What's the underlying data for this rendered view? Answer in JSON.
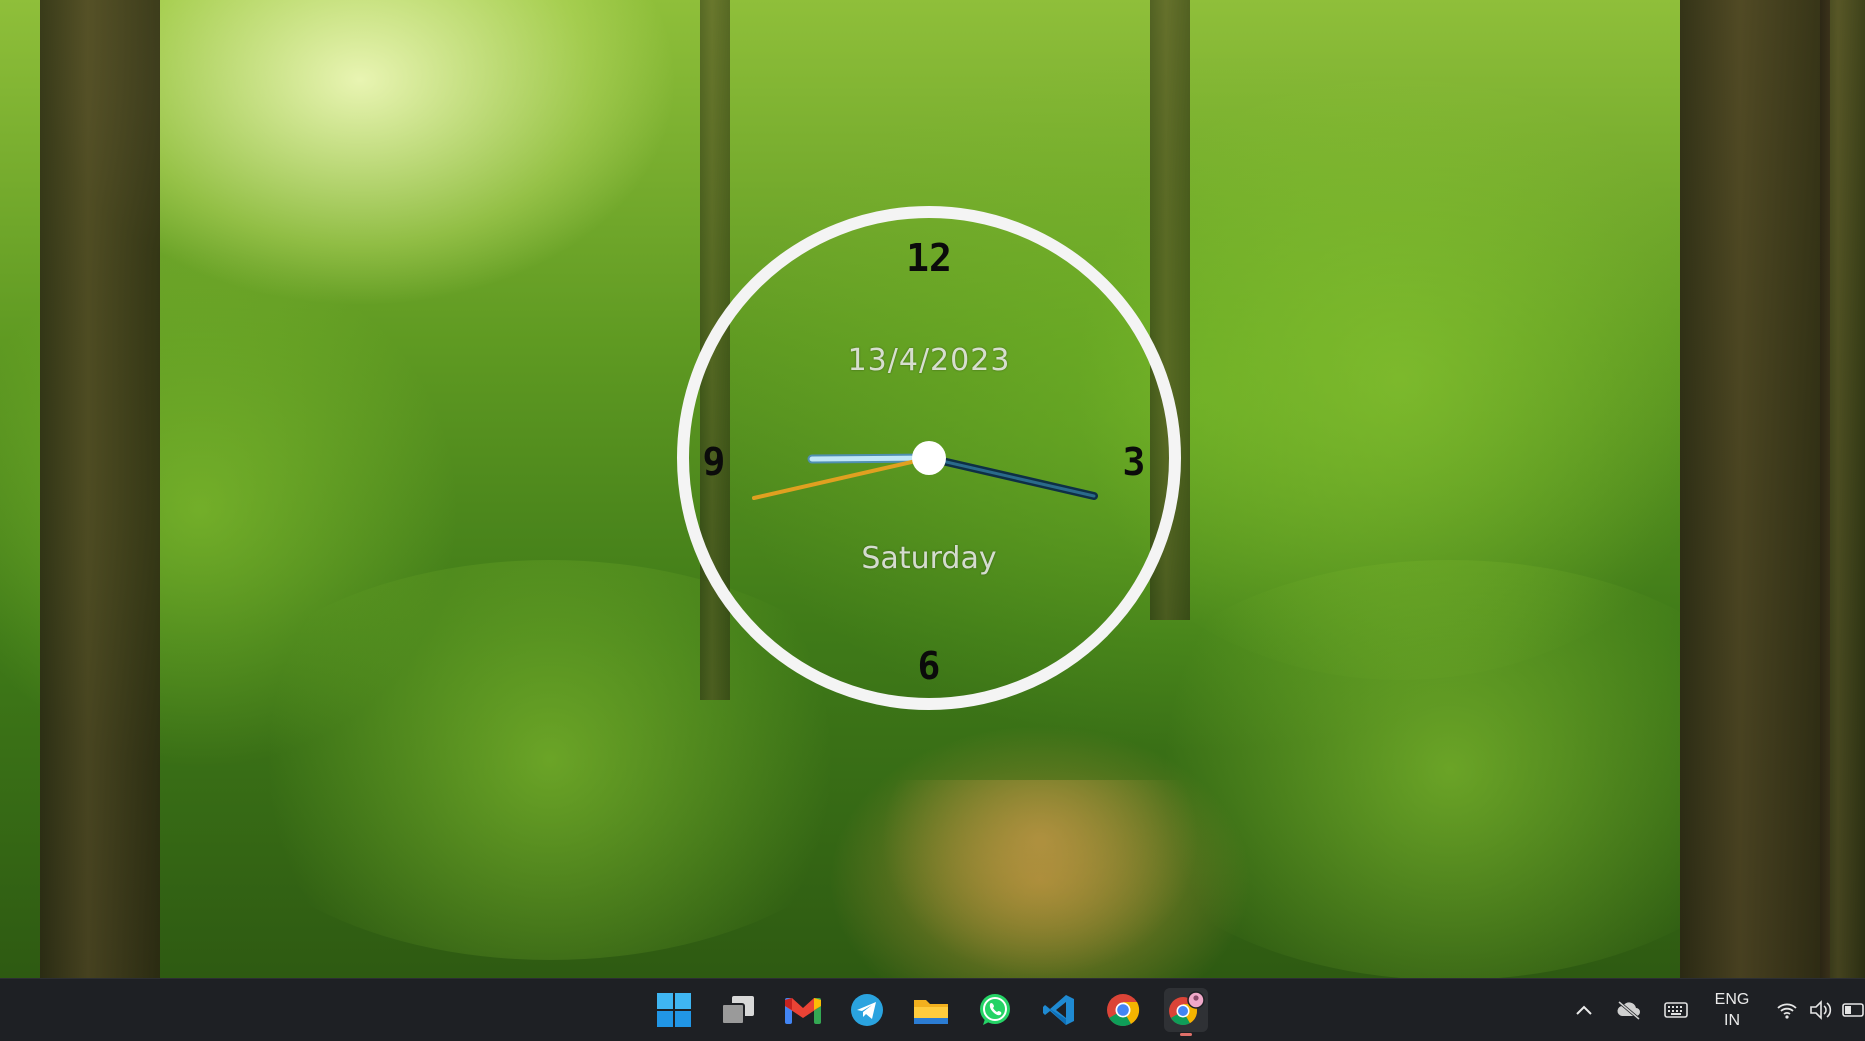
{
  "clock": {
    "numerals": {
      "twelve": "12",
      "three": "3",
      "six": "6",
      "nine": "9"
    },
    "date": "13/4/2023",
    "day": "Saturday",
    "hands": {
      "hour_color": "#123a52",
      "minute_color": "#9fd4ef",
      "second_color": "#e0a020"
    },
    "ring_color": "#f4f4f4"
  },
  "taskbar": {
    "apps": [
      {
        "name": "start-button",
        "icon": "windows-icon"
      },
      {
        "name": "task-view-button",
        "icon": "task-view-icon"
      },
      {
        "name": "gmail-button",
        "icon": "gmail-icon"
      },
      {
        "name": "telegram-button",
        "icon": "telegram-icon"
      },
      {
        "name": "file-explorer-button",
        "icon": "folder-icon"
      },
      {
        "name": "whatsapp-button",
        "icon": "whatsapp-icon"
      },
      {
        "name": "vscode-button",
        "icon": "vscode-icon"
      },
      {
        "name": "chrome-button",
        "icon": "chrome-icon"
      },
      {
        "name": "chrome-profile-button",
        "icon": "chrome-profile-icon",
        "active": true
      }
    ],
    "tray": {
      "language_line1": "ENG",
      "language_line2": "IN"
    }
  }
}
